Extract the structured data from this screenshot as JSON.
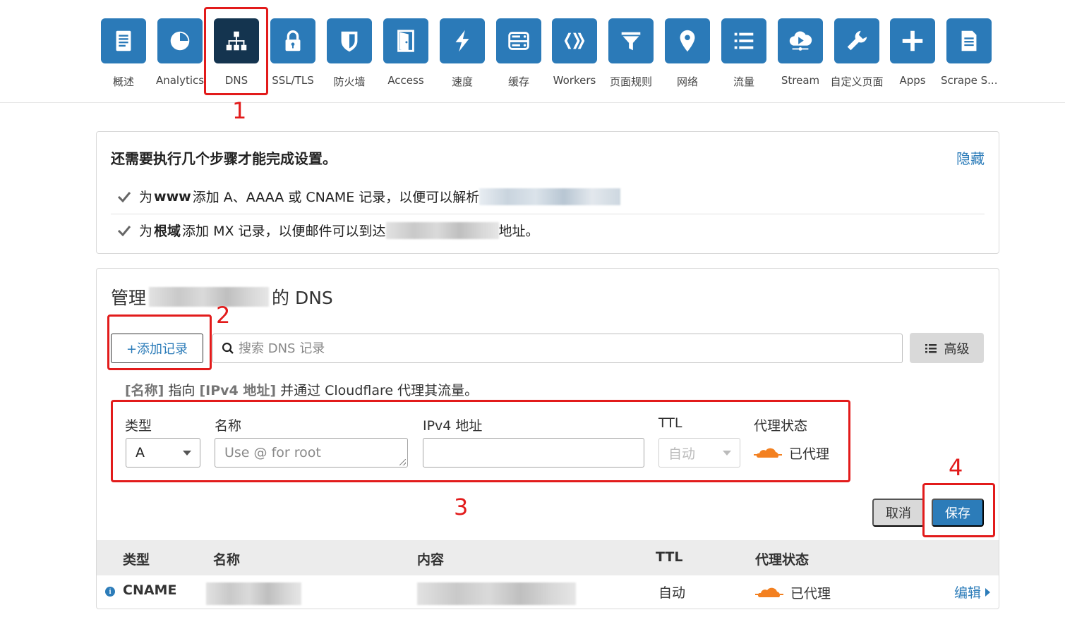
{
  "nav": {
    "items": [
      {
        "label": "概述",
        "icon": "document-icon"
      },
      {
        "label": "Analytics",
        "icon": "pie-chart-icon"
      },
      {
        "label": "DNS",
        "icon": "network-tree-icon",
        "active": true
      },
      {
        "label": "SSL/TLS",
        "icon": "lock-icon"
      },
      {
        "label": "防火墙",
        "icon": "shield-icon"
      },
      {
        "label": "Access",
        "icon": "door-icon"
      },
      {
        "label": "速度",
        "icon": "lightning-icon"
      },
      {
        "label": "缓存",
        "icon": "server-icon"
      },
      {
        "label": "Workers",
        "icon": "workers-icon"
      },
      {
        "label": "页面规则",
        "icon": "filter-icon"
      },
      {
        "label": "网络",
        "icon": "location-pin-icon"
      },
      {
        "label": "流量",
        "icon": "list-icon"
      },
      {
        "label": "Stream",
        "icon": "cloud-play-icon"
      },
      {
        "label": "自定义页面",
        "icon": "wrench-icon"
      },
      {
        "label": "Apps",
        "icon": "plus-icon"
      },
      {
        "label": "Scrape S...",
        "icon": "page-icon"
      }
    ]
  },
  "annotations": {
    "n1": "1",
    "n2": "2",
    "n3": "3",
    "n4": "4"
  },
  "setup": {
    "title": "还需要执行几个步骤才能完成设置。",
    "hide": "隐藏",
    "step1": {
      "pre": "为 ",
      "bold": "www",
      "post": " 添加 A、AAAA 或 CNAME 记录，以便可以解析"
    },
    "step2": {
      "pre": "为 ",
      "bold": "根域",
      "post": " 添加 MX 记录，以便邮件可以到达",
      "tail": "地址。"
    }
  },
  "dns": {
    "title_pre": "管理",
    "title_post": "的 DNS",
    "add_record": "+添加记录",
    "search_placeholder": "搜索 DNS 记录",
    "advanced": "高级",
    "hint": {
      "name": "[名称]",
      "mid": " 指向 ",
      "ip": "[IPv4 地址]",
      "tail": " 并通过 Cloudflare 代理其流量。"
    },
    "form": {
      "type_label": "类型",
      "type_value": "A",
      "name_label": "名称",
      "name_placeholder": "Use @ for root",
      "ipv4_label": "IPv4 地址",
      "ipv4_value": "",
      "ttl_label": "TTL",
      "ttl_value": "自动",
      "proxy_label": "代理状态",
      "proxy_value": "已代理"
    },
    "cancel": "取消",
    "save": "保存",
    "table": {
      "headers": [
        "类型",
        "名称",
        "内容",
        "TTL",
        "代理状态"
      ],
      "rows": [
        {
          "type": "CNAME",
          "ttl": "自动",
          "proxy": "已代理",
          "edit": "编辑"
        }
      ]
    }
  },
  "colors": {
    "accent": "#2c7cb9",
    "nav_tile": "#2b7ab8",
    "nav_tile_active": "#14344f",
    "annotation": "#e21b1b",
    "cloud": "#f38020"
  }
}
